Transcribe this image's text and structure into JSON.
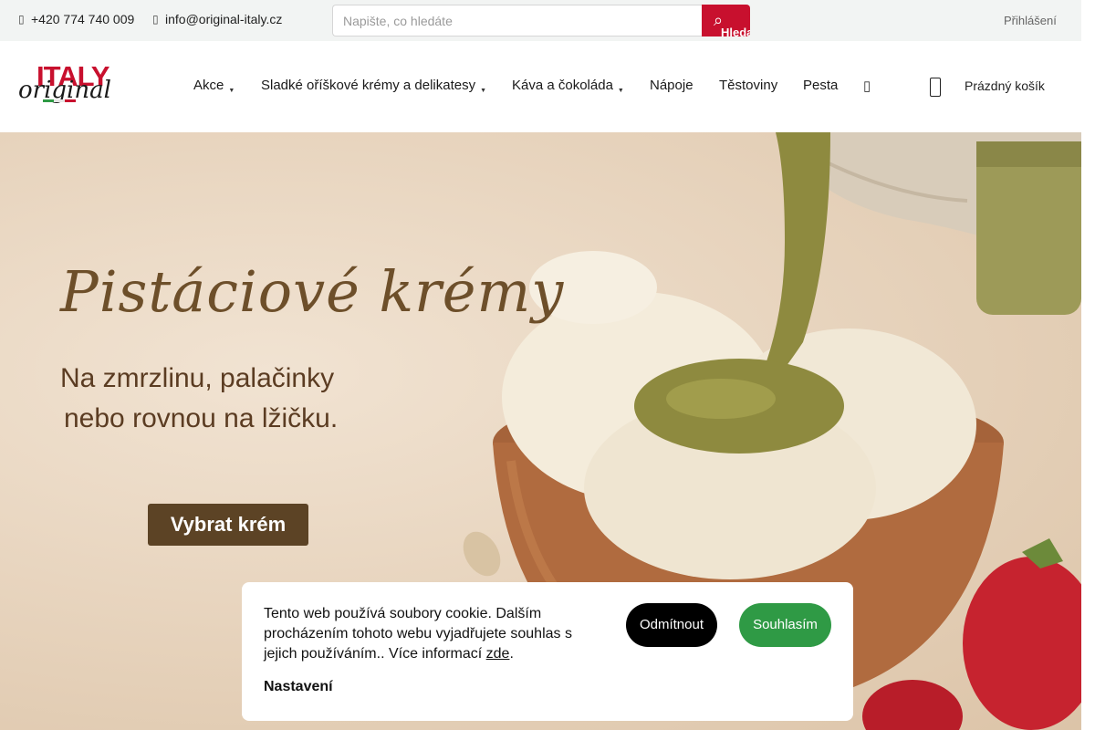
{
  "topbar": {
    "phone": "+420 774 740 009",
    "email": "info@original-italy.cz",
    "search": {
      "placeholder": "Napište, co hledáte",
      "button_label": "Hledat"
    },
    "login": "Přihlášení"
  },
  "logo": {
    "word1": "ITALY",
    "word2": "original"
  },
  "nav": {
    "items": [
      {
        "label": "Akce",
        "caret": "▼"
      },
      {
        "label": "Sladké oříškové krémy a delikatesy",
        "caret": "▼"
      },
      {
        "label": "Káva a čokoláda",
        "caret": "▼"
      },
      {
        "label": "Nápoje"
      },
      {
        "label": "Těstoviny"
      },
      {
        "label": "Pesta"
      }
    ]
  },
  "cart": {
    "label": "Prázdný košík"
  },
  "hero": {
    "title": "Pistáciové krémy",
    "subtitle_line1": "Na zmrzlinu, palačinky",
    "subtitle_line2": "nebo rovnou na lžičku.",
    "cta": "Vybrat krém"
  },
  "cookie": {
    "text_before_link": "Tento web používá soubory cookie. Dalším procházením tohoto webu vyjadřujete souhlas s jejich používáním.. Více informací ",
    "link": "zde",
    "text_after_link": ".",
    "settings": "Nastavení",
    "decline": "Odmítnout",
    "accept": "Souhlasím"
  },
  "colors": {
    "brand_red": "#c8102e",
    "accept_green": "#2f9a45",
    "cta_brown": "#5c4325",
    "pistachio": "#8e8a3f"
  },
  "icons": [
    "phone-icon",
    "email-icon",
    "search-icon",
    "more-icon",
    "cart-icon"
  ]
}
